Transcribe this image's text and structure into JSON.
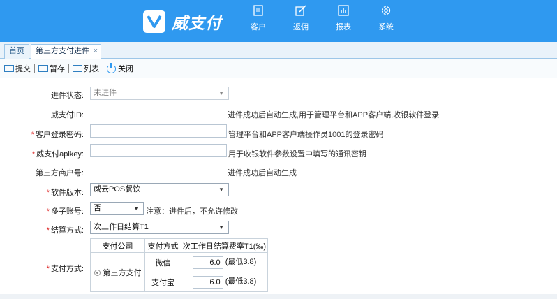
{
  "header": {
    "logo_text": "威支付",
    "nav": [
      {
        "label": "客户",
        "icon": "document-icon"
      },
      {
        "label": "返佣",
        "icon": "edit-icon"
      },
      {
        "label": "报表",
        "icon": "chart-icon"
      },
      {
        "label": "系统",
        "icon": "gear-icon"
      }
    ],
    "accent_color": "#2f99f0"
  },
  "tabs": {
    "home": "首页",
    "active": "第三方支付进件",
    "close": "×"
  },
  "toolbar": {
    "submit": "提交",
    "draft": "暂存",
    "list": "列表",
    "close": "关闭"
  },
  "form": {
    "status": {
      "label": "进件状态:",
      "value": "未进件"
    },
    "pay_id": {
      "label": "威支付ID:",
      "hint": "进件成功后自动生成,用于管理平台和APP客户端,收银软件登录"
    },
    "login_password": {
      "label": "客户登录密码:",
      "hint": "管理平台和APP客户端操作员1001的登录密码"
    },
    "apikey": {
      "label": "威支付apikey:",
      "hint": "用于收银软件参数设置中填写的通讯密钥"
    },
    "merchant_no": {
      "label": "第三方商户号:",
      "hint": "进件成功后自动生成"
    },
    "software_version": {
      "label": "软件版本:",
      "value": "威云POS餐饮"
    },
    "sub_accounts": {
      "label": "多子账号:",
      "value": "否",
      "hint": "注意：进件后，不允许修改"
    },
    "settlement": {
      "label": "结算方式:",
      "value": "次工作日结算T1"
    },
    "payment_method": {
      "label": "支付方式:",
      "columns": [
        "支付公司",
        "支付方式",
        "次工作日结算费率T1(‰)"
      ],
      "company": "第三方支付",
      "rows": [
        {
          "method": "微信",
          "rate": "6.0",
          "min_note": "(最低3.8)"
        },
        {
          "method": "支付宝",
          "rate": "6.0",
          "min_note": "(最低3.8)"
        }
      ]
    }
  }
}
